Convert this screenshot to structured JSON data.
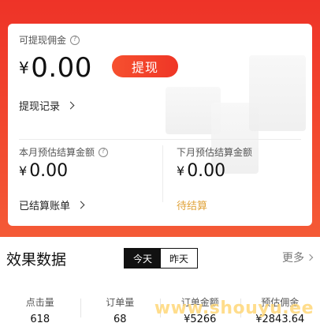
{
  "balance": {
    "label": "可提现佣金",
    "help": "?",
    "currency": "¥",
    "amount": "0.00",
    "withdraw_label": "提现",
    "records_label": "提现记录"
  },
  "this_month": {
    "label": "本月预估结算金额",
    "help": "?",
    "currency": "¥",
    "amount": "0.00",
    "link_label": "已结算账单"
  },
  "next_month": {
    "label": "下月预估结算金额",
    "currency": "¥",
    "amount": "0.00",
    "status_label": "待结算"
  },
  "effect": {
    "title": "效果数据",
    "tabs": [
      {
        "label": "今天",
        "active": true
      },
      {
        "label": "昨天",
        "active": false
      }
    ],
    "more_label": "更多",
    "stats": [
      {
        "label": "点击量",
        "value": "618"
      },
      {
        "label": "订单量",
        "value": "68"
      },
      {
        "label": "订单金额",
        "value": "¥5266"
      },
      {
        "label": "预估佣金",
        "value": "¥2843.64"
      }
    ]
  },
  "watermark": "www.shouyu.ee",
  "colors": {
    "brand_red": "#ee3328",
    "pending_gold": "#e0a33a"
  }
}
